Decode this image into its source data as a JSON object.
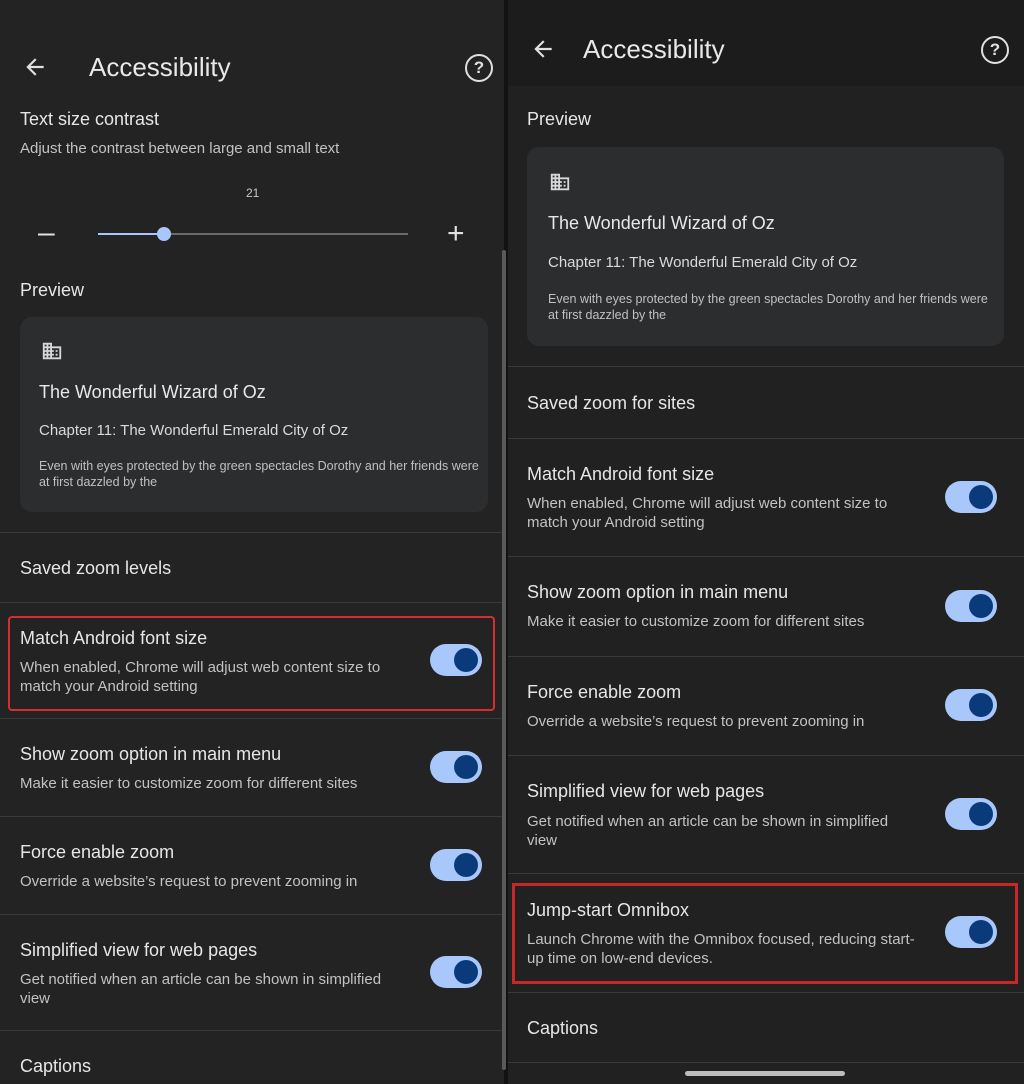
{
  "left": {
    "title": "Accessibility",
    "text_size_contrast": {
      "title": "Text size contrast",
      "subtitle": "Adjust the contrast between large and small text",
      "value": "21",
      "decrease_symbol": "–",
      "increase_symbol": "+"
    },
    "preview": {
      "header": "Preview",
      "book_title": "The Wonderful Wizard of Oz",
      "chapter": "Chapter 11: The Wonderful Emerald City of Oz",
      "body": "Even with eyes protected by the green spectacles Dorothy and her friends were at first dazzled by the"
    },
    "saved_zoom": "Saved zoom levels",
    "settings": [
      {
        "title": "Match Android font size",
        "subtitle": "When enabled, Chrome will adjust web content size to match your Android setting",
        "enabled": true
      },
      {
        "title": "Show zoom option in main menu",
        "subtitle": "Make it easier to customize zoom for different sites",
        "enabled": true
      },
      {
        "title": "Force enable zoom",
        "subtitle": "Override a website’s request to prevent zooming in",
        "enabled": true
      },
      {
        "title": "Simplified view for web pages",
        "subtitle": "Get notified when an article can be shown in simplified view",
        "enabled": true
      }
    ],
    "captions": "Captions"
  },
  "right": {
    "title": "Accessibility",
    "preview": {
      "header": "Preview",
      "book_title": "The Wonderful Wizard of Oz",
      "chapter": "Chapter 11: The Wonderful Emerald City of Oz",
      "body": "Even with eyes protected by the green spectacles Dorothy and her friends were at first dazzled by the"
    },
    "saved_zoom": "Saved zoom for sites",
    "settings": [
      {
        "title": "Match Android font size",
        "subtitle": "When enabled, Chrome will adjust web content size to match your Android setting",
        "enabled": true
      },
      {
        "title": "Show zoom option in main menu",
        "subtitle": "Make it easier to customize zoom for different sites",
        "enabled": true
      },
      {
        "title": "Force enable zoom",
        "subtitle": "Override a website’s request to prevent zooming in",
        "enabled": true
      },
      {
        "title": "Simplified view for web pages",
        "subtitle": "Get notified when an article can be shown in simplified view",
        "enabled": true
      },
      {
        "title": "Jump-start Omnibox",
        "subtitle": "Launch Chrome with the Omnibox focused, reducing start-up time on low-end devices.",
        "enabled": true
      }
    ],
    "captions": "Captions"
  },
  "icons": {
    "back": "back-arrow-icon",
    "help": "help-icon",
    "preview": "building-icon"
  },
  "colors": {
    "toggle_track": "#a8c7fa",
    "toggle_knob": "#0b3a7a",
    "highlight": "#d32f2f"
  }
}
